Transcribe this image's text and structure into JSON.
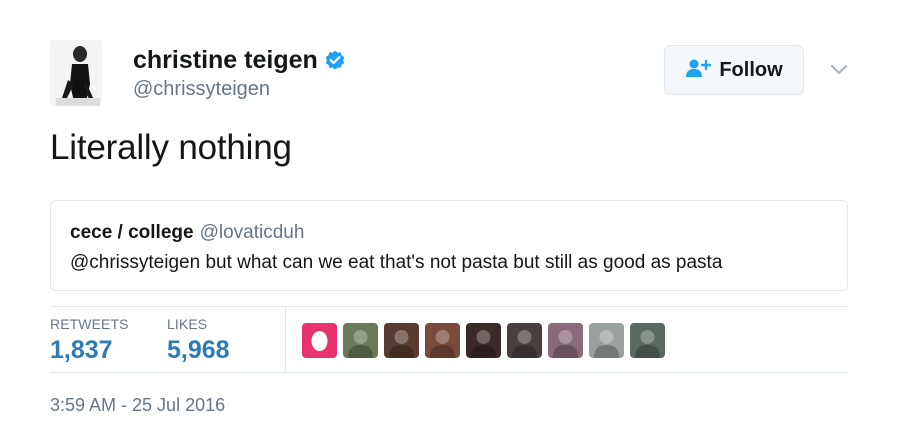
{
  "author": {
    "display_name": "christine teigen",
    "handle": "@chrissyteigen",
    "verified": true,
    "avatar_icon": "profile-photo-icon"
  },
  "follow_button": {
    "label": "Follow",
    "icon": "add-user-icon"
  },
  "menu": {
    "icon": "chevron-down-icon"
  },
  "tweet": {
    "text": "Literally nothing"
  },
  "quoted_tweet": {
    "name": "cece / college",
    "handle": "@lovaticduh",
    "text": "@chrissyteigen but what can we eat that's not pasta but still as good as pasta"
  },
  "stats": {
    "retweets_label": "RETWEETS",
    "retweets_value": "1,837",
    "likes_label": "LIKES",
    "likes_value": "5,968"
  },
  "likers": [
    {
      "name": "liker-avatar-1",
      "color": "#e8336d"
    },
    {
      "name": "liker-avatar-2",
      "color": "#6b7a5a"
    },
    {
      "name": "liker-avatar-3",
      "color": "#5a3b30"
    },
    {
      "name": "liker-avatar-4",
      "color": "#7a4a3e"
    },
    {
      "name": "liker-avatar-5",
      "color": "#3a2a28"
    },
    {
      "name": "liker-avatar-6",
      "color": "#4a4040"
    },
    {
      "name": "liker-avatar-7",
      "color": "#8a6a7a"
    },
    {
      "name": "liker-avatar-8",
      "color": "#9aa0a0"
    },
    {
      "name": "liker-avatar-9",
      "color": "#5a6a60"
    }
  ],
  "timestamp": "3:59 AM - 25 Jul 2016",
  "colors": {
    "link_blue": "#2b7bb9",
    "verified_blue": "#1da1f2",
    "secondary_text": "#657786",
    "border": "#e1e8ed"
  }
}
